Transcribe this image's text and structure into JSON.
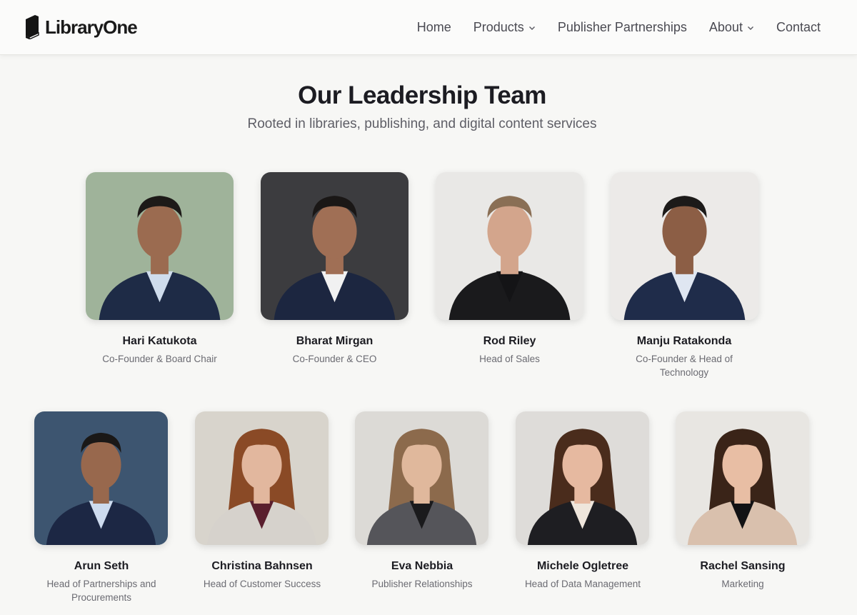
{
  "brand": {
    "name": "LibraryOne"
  },
  "nav": {
    "items": [
      {
        "label": "Home",
        "dropdown": false
      },
      {
        "label": "Products",
        "dropdown": true
      },
      {
        "label": "Publisher Partnerships",
        "dropdown": false
      },
      {
        "label": "About",
        "dropdown": true
      },
      {
        "label": "Contact",
        "dropdown": false
      }
    ]
  },
  "hero": {
    "title": "Our Leadership Team",
    "subtitle": "Rooted in libraries, publishing, and digital content services"
  },
  "team": [
    {
      "name": "Hari Katukota",
      "role": "Co-Founder & Board Chair",
      "photo": "portrait-man-navy-suit-outdoor",
      "bg": "#9fb39a",
      "hair": "#1d1a18",
      "skin": "#9b6b50",
      "top": "#1e2b46",
      "shirt": "#cfdcec"
    },
    {
      "name": "Bharat Mirgan",
      "role": "Co-Founder & CEO",
      "photo": "portrait-man-glasses-dark-bg",
      "bg": "#3c3c3f",
      "hair": "#1a1716",
      "skin": "#a06f55",
      "top": "#1c2640",
      "shirt": "#f1f1f1"
    },
    {
      "name": "Rod Riley",
      "role": "Head of Sales",
      "photo": "portrait-man-black-tee",
      "bg": "#e9e8e6",
      "hair": "#8a6f55",
      "skin": "#d3a58c",
      "top": "#1a1a1c",
      "shirt": "#141416"
    },
    {
      "name": "Manju Ratakonda",
      "role": "Co-Founder & Head of Technology",
      "photo": "portrait-man-navy-suit-light-bg",
      "bg": "#eceae8",
      "hair": "#1c1a19",
      "skin": "#8c5e45",
      "top": "#1f2c4a",
      "shirt": "#dfe6f1"
    },
    {
      "name": "Arun Seth",
      "role": "Head of Partnerships and Procurements",
      "photo": "portrait-man-office-bg",
      "bg": "#3d5570",
      "hair": "#1a1817",
      "skin": "#98684d",
      "top": "#1c2744",
      "shirt": "#cddbef"
    },
    {
      "name": "Christina Bahnsen",
      "role": "Head of Customer Success",
      "photo": "portrait-woman-auburn-hair",
      "bg": "#d8d4cc",
      "hair": "#8a4a26",
      "skin": "#e2b79e",
      "top": "#d6d2cc",
      "shirt": "#5a1f2e"
    },
    {
      "name": "Eva Nebbia",
      "role": "Publisher Relationships",
      "photo": "portrait-woman-grey-blazer",
      "bg": "#dcdad6",
      "hair": "#8c6a4c",
      "skin": "#e0b89c",
      "top": "#55555a",
      "shirt": "#1a1a1c"
    },
    {
      "name": "Michele Ogletree",
      "role": "Head of Data Management",
      "photo": "portrait-woman-dark-blazer",
      "bg": "#dedcd9",
      "hair": "#4a2c1c",
      "skin": "#e6b9a0",
      "top": "#1e1e22",
      "shirt": "#efe6dc"
    },
    {
      "name": "Rachel Sansing",
      "role": "Marketing",
      "photo": "portrait-woman-beige-blazer",
      "bg": "#e8e6e2",
      "hair": "#3a2418",
      "skin": "#e8bea4",
      "top": "#d9c0ad",
      "shirt": "#121214"
    }
  ]
}
